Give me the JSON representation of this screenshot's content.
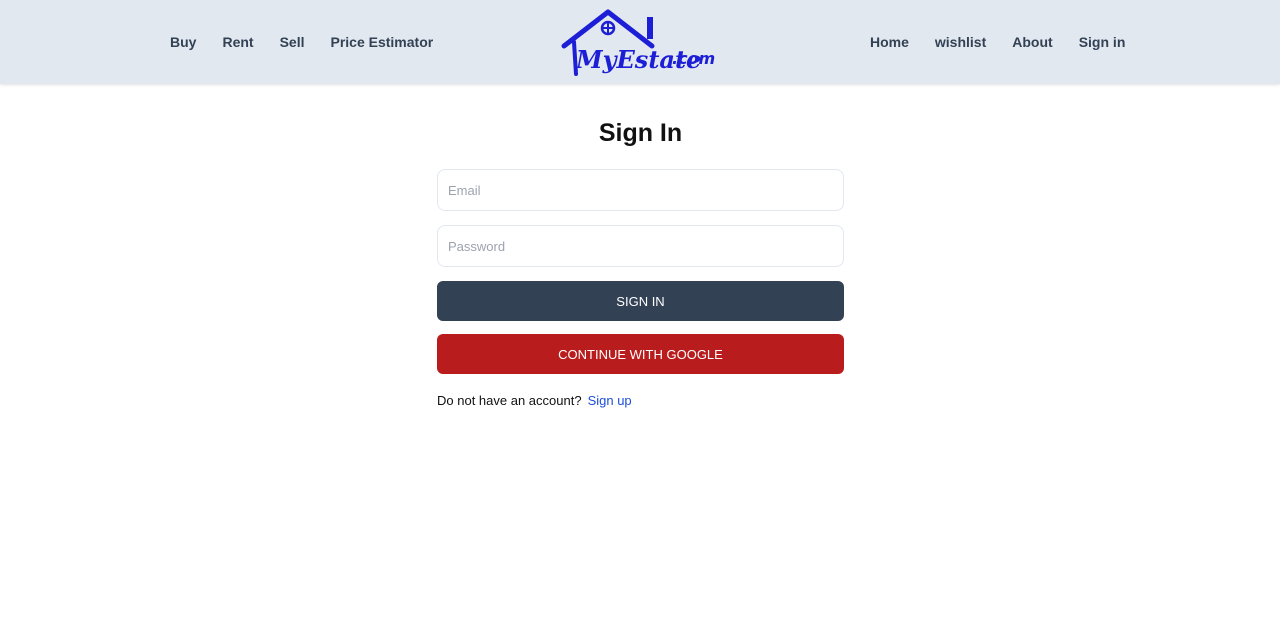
{
  "nav": {
    "left": [
      {
        "label": "Buy"
      },
      {
        "label": "Rent"
      },
      {
        "label": "Sell"
      },
      {
        "label": "Price Estimator"
      }
    ],
    "right": [
      {
        "label": "Home"
      },
      {
        "label": "wishlist"
      },
      {
        "label": "About"
      },
      {
        "label": "Sign in"
      }
    ]
  },
  "logo": {
    "text": "MyEstate.com",
    "color": "#1d1fd6"
  },
  "signin": {
    "title": "Sign In",
    "email_placeholder": "Email",
    "password_placeholder": "Password",
    "submit_label": "SIGN IN",
    "google_label": "CONTINUE WITH GOOGLE",
    "no_account_text": "Do not have an account?",
    "signup_link": "Sign up"
  },
  "colors": {
    "header_bg": "#e2e8f0",
    "signin_button": "#334155",
    "google_button": "#b91c1c",
    "link": "#1d4ed8"
  }
}
